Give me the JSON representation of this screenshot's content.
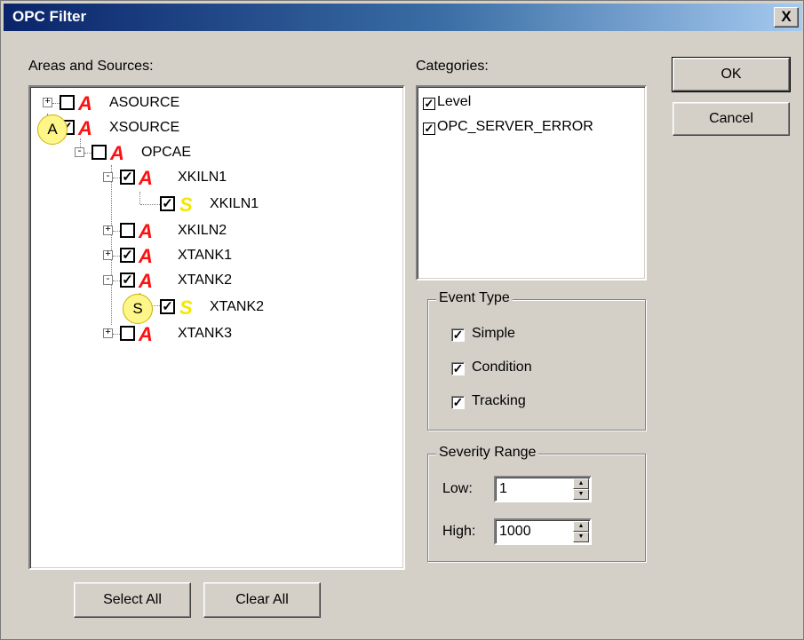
{
  "window": {
    "title": "OPC Filter",
    "close_glyph": "X"
  },
  "areas_label": "Areas and Sources:",
  "categories_label": "Categories:",
  "tree": {
    "nodes": [
      {
        "label": "ASOURCE",
        "type": "area",
        "checked": false,
        "expander": "+"
      },
      {
        "label": "XSOURCE",
        "type": "area",
        "checked": true,
        "expander": "-"
      },
      {
        "label": "OPCAE",
        "type": "area",
        "checked": false,
        "expander": "-"
      },
      {
        "label": "XKILN1",
        "type": "area",
        "checked": true,
        "expander": "-"
      },
      {
        "label": "XKILN1",
        "type": "source",
        "checked": true
      },
      {
        "label": "XKILN2",
        "type": "area",
        "checked": false,
        "expander": "+"
      },
      {
        "label": "XTANK1",
        "type": "area",
        "checked": true,
        "expander": "+"
      },
      {
        "label": "XTANK2",
        "type": "area",
        "checked": true,
        "expander": "-"
      },
      {
        "label": "XTANK2",
        "type": "source",
        "checked": true
      },
      {
        "label": "XTANK3",
        "type": "area",
        "checked": false,
        "expander": "+"
      }
    ],
    "area_glyph": "A",
    "source_glyph": "S",
    "callout_area": "A",
    "callout_source": "S"
  },
  "categories": [
    {
      "label": "Level",
      "checked": true
    },
    {
      "label": "OPC_SERVER_ERROR",
      "checked": true
    }
  ],
  "event_type": {
    "title": "Event Type",
    "options": [
      {
        "label": "Simple",
        "checked": true
      },
      {
        "label": "Condition",
        "checked": true
      },
      {
        "label": "Tracking",
        "checked": true
      }
    ]
  },
  "severity": {
    "title": "Severity Range",
    "low_label": "Low:",
    "low_value": "1",
    "high_label": "High:",
    "high_value": "1000"
  },
  "buttons": {
    "ok": "OK",
    "cancel": "Cancel",
    "select_all": "Select All",
    "clear_all": "Clear All"
  },
  "icons": {
    "check": "✓",
    "spin_up": "▲",
    "spin_down": "▼"
  },
  "colors": {
    "title_start": "#0a246a",
    "title_end": "#a6caf0",
    "area_glyph": "#ff1010",
    "source_glyph": "#f5e600",
    "callout": "#fff68a"
  }
}
